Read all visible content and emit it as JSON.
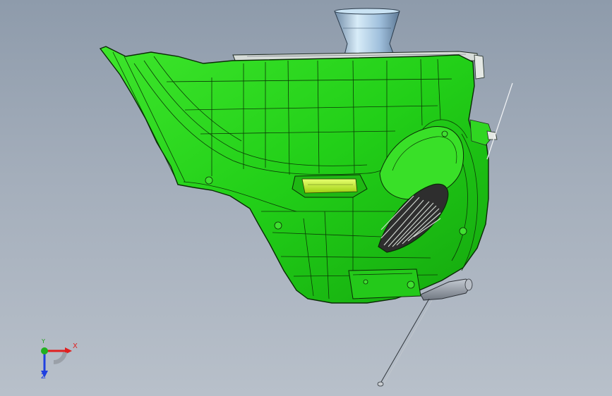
{
  "viewport": {
    "background_top": "#8e9bab",
    "background_bottom": "#b8c0ca"
  },
  "model": {
    "part_color": "#27d61c",
    "edge_color": "#0a2a06",
    "insert_color": "#c8f020",
    "speaker_grille_color": "#7a8a7a",
    "nozzle_color": "#a9cbe6",
    "handle_color": "#9aa2ac"
  },
  "triad": {
    "x_label": "X",
    "y_label": "Y",
    "z_label": "Z",
    "x_color": "#e02020",
    "y_color": "#20a020",
    "z_color": "#2040e0"
  }
}
